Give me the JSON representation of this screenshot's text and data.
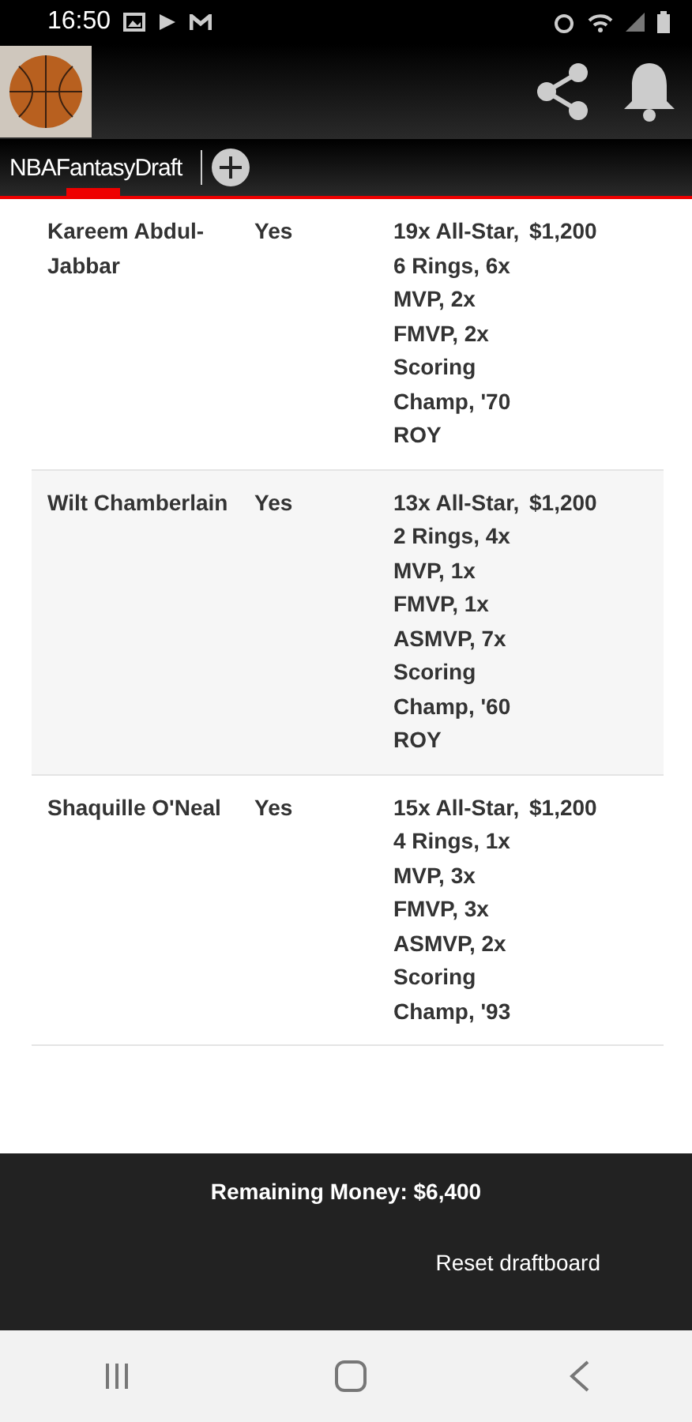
{
  "status_bar": {
    "time": "16:50"
  },
  "app_bar": {
    "tabs": [
      {
        "label": "NBAFantasyDraft",
        "selected": true
      }
    ]
  },
  "table": {
    "rows": [
      {
        "name": "Kareem Abdul-Jabbar",
        "available": "Yes",
        "accolades": "19x All-Star, 6 Rings, 6x MVP, 2x FMVP, 2x Scoring Champ, '70 ROY",
        "price": "$1,200"
      },
      {
        "name": "Wilt Chamberlain",
        "available": "Yes",
        "accolades": "13x All-Star, 2 Rings, 4x MVP, 1x FMVP, 1x ASMVP, 7x Scoring Champ, '60 ROY",
        "price": "$1,200"
      },
      {
        "name": "Shaquille O'Neal",
        "available": "Yes",
        "accolades": "15x All-Star, 4 Rings, 1x MVP, 3x FMVP, 3x ASMVP, 2x Scoring Champ, '93",
        "price": "$1,200"
      }
    ]
  },
  "footer": {
    "remaining": "Remaining Money: $6,400",
    "reset": "Reset draftboard"
  }
}
